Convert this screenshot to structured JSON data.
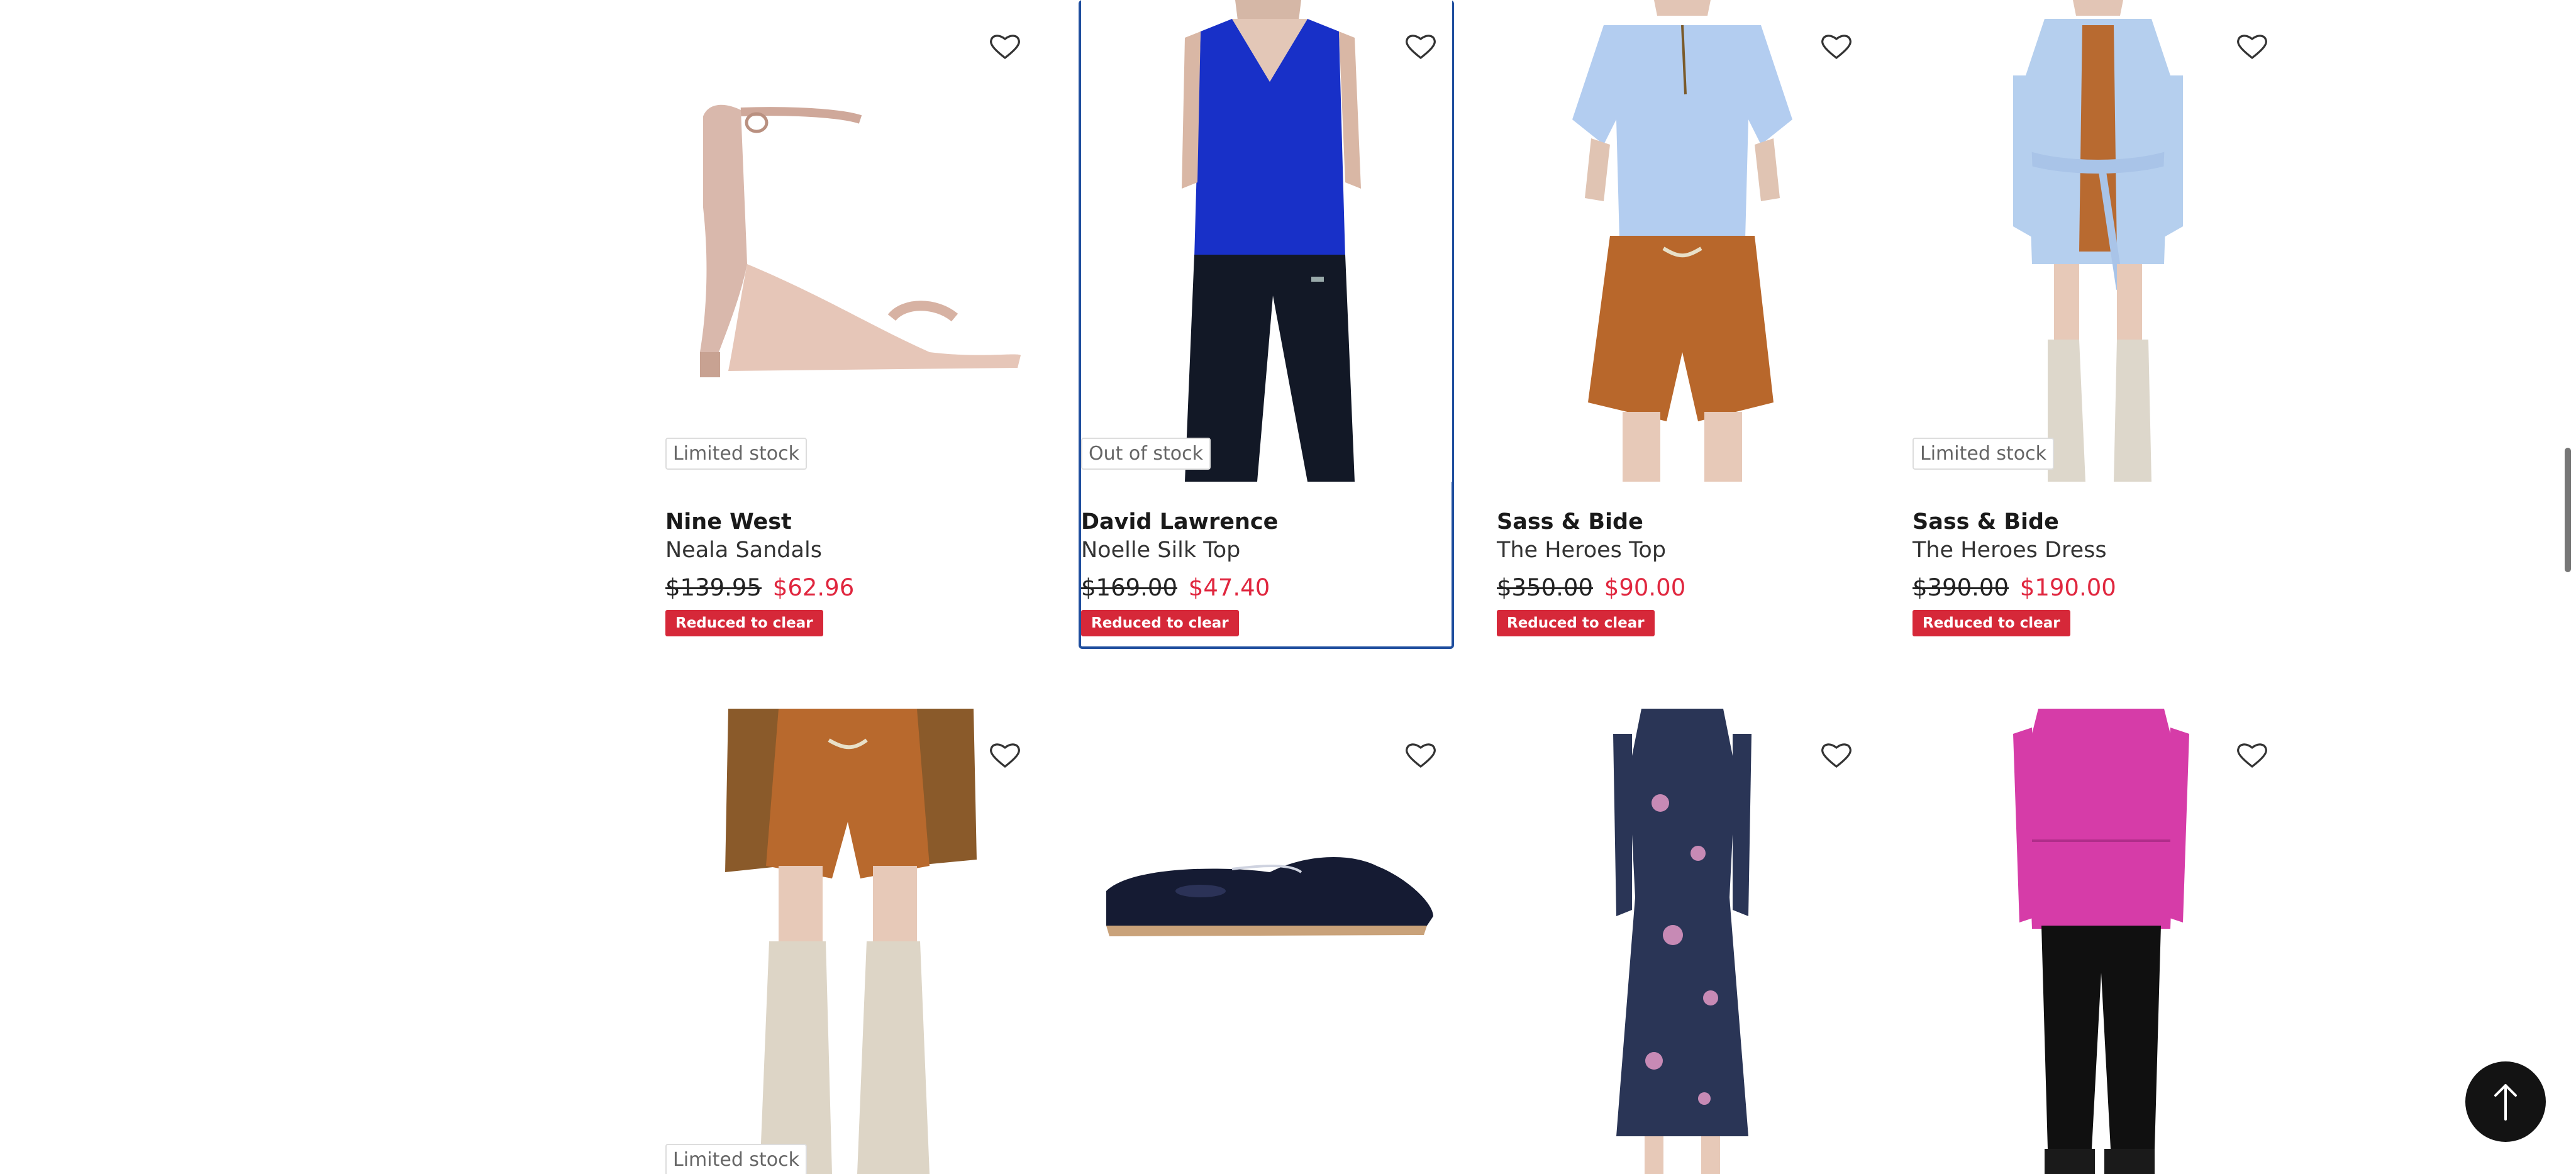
{
  "colors": {
    "accent": "#1f4e9e",
    "sale": "#e0263e",
    "badge": "#d62839"
  },
  "icons": {
    "wishlist": "heart-outline-icon",
    "back_to_top": "arrow-up-icon"
  },
  "products": [
    {
      "brand": "Nine West",
      "name": "Neala Sandals",
      "was_price": "$139.95",
      "now_price": "$62.96",
      "badge": "Reduced to clear",
      "stock": "Limited stock"
    },
    {
      "brand": "David Lawrence",
      "name": "Noelle Silk Top",
      "was_price": "$169.00",
      "now_price": "$47.40",
      "badge": "Reduced to clear",
      "stock": "Out of stock"
    },
    {
      "brand": "Sass & Bide",
      "name": "The Heroes Top",
      "was_price": "$350.00",
      "now_price": "$90.00",
      "badge": "Reduced to clear",
      "stock": ""
    },
    {
      "brand": "Sass & Bide",
      "name": "The Heroes Dress",
      "was_price": "$390.00",
      "now_price": "$190.00",
      "badge": "Reduced to clear",
      "stock": "Limited stock"
    },
    {
      "stock": "Limited stock"
    },
    {
      "stock": ""
    },
    {
      "stock": ""
    },
    {
      "stock": ""
    }
  ]
}
